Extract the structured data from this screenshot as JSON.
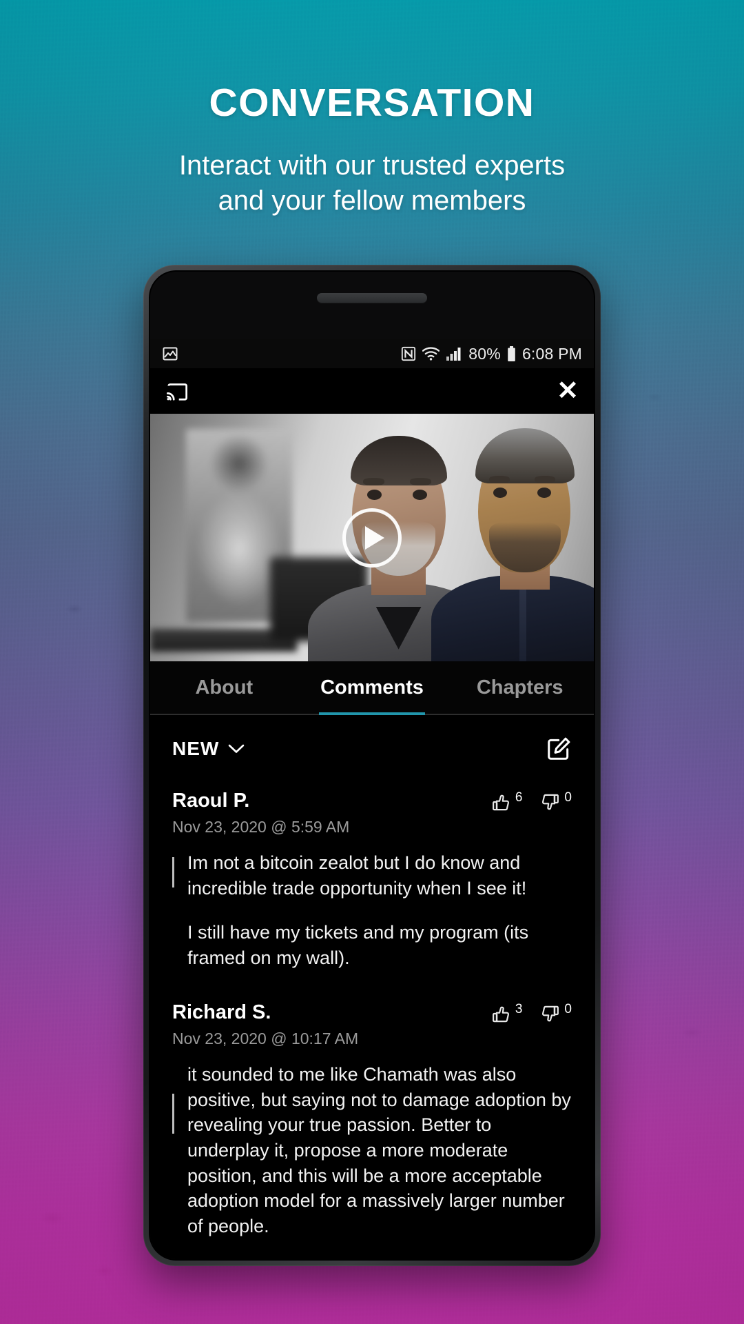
{
  "promo": {
    "headline": "CONVERSATION",
    "subhead_line1": "Interact with our trusted experts",
    "subhead_line2": "and your fellow members"
  },
  "theme": {
    "accent": "#2196ac",
    "background_top": "#00a9bb",
    "background_mid": "#51648f",
    "background_bottom": "#c82fae",
    "screen_background": "#000000"
  },
  "status_bar": {
    "notification_icon": "image-icon",
    "nfc_icon": "nfc-icon",
    "wifi_icon": "wifi-icon",
    "signal_icon": "cellular-signal-icon",
    "battery_percent": "80%",
    "battery_icon": "battery-icon",
    "time": "6:08 PM"
  },
  "player": {
    "cast_icon": "cast-icon",
    "close_label": "✕",
    "play_icon": "play-icon"
  },
  "tabs": [
    {
      "label": "About",
      "active": false
    },
    {
      "label": "Comments",
      "active": true
    },
    {
      "label": "Chapters",
      "active": false
    }
  ],
  "sort": {
    "label": "NEW",
    "chevron_icon": "chevron-down-icon",
    "compose_icon": "compose-icon"
  },
  "comments": [
    {
      "author": "Raoul P.",
      "timestamp": "Nov 23, 2020 @ 5:59 AM",
      "upvotes": "6",
      "downvotes": "0",
      "paragraphs": [
        "Im not a bitcoin zealot but I do know and incredible trade opportunity when I see it!",
        "I still have my tickets and my program (its framed on my wall)."
      ]
    },
    {
      "author": "Richard S.",
      "timestamp": "Nov 23, 2020 @ 10:17 AM",
      "upvotes": "3",
      "downvotes": "0",
      "paragraphs": [
        "it sounded to me like Chamath was also positive, but saying not to damage adoption by revealing your true passion. Better to underplay it, propose a more moderate position, and this will be a more acceptable adoption model for a massively larger number of people."
      ]
    }
  ]
}
